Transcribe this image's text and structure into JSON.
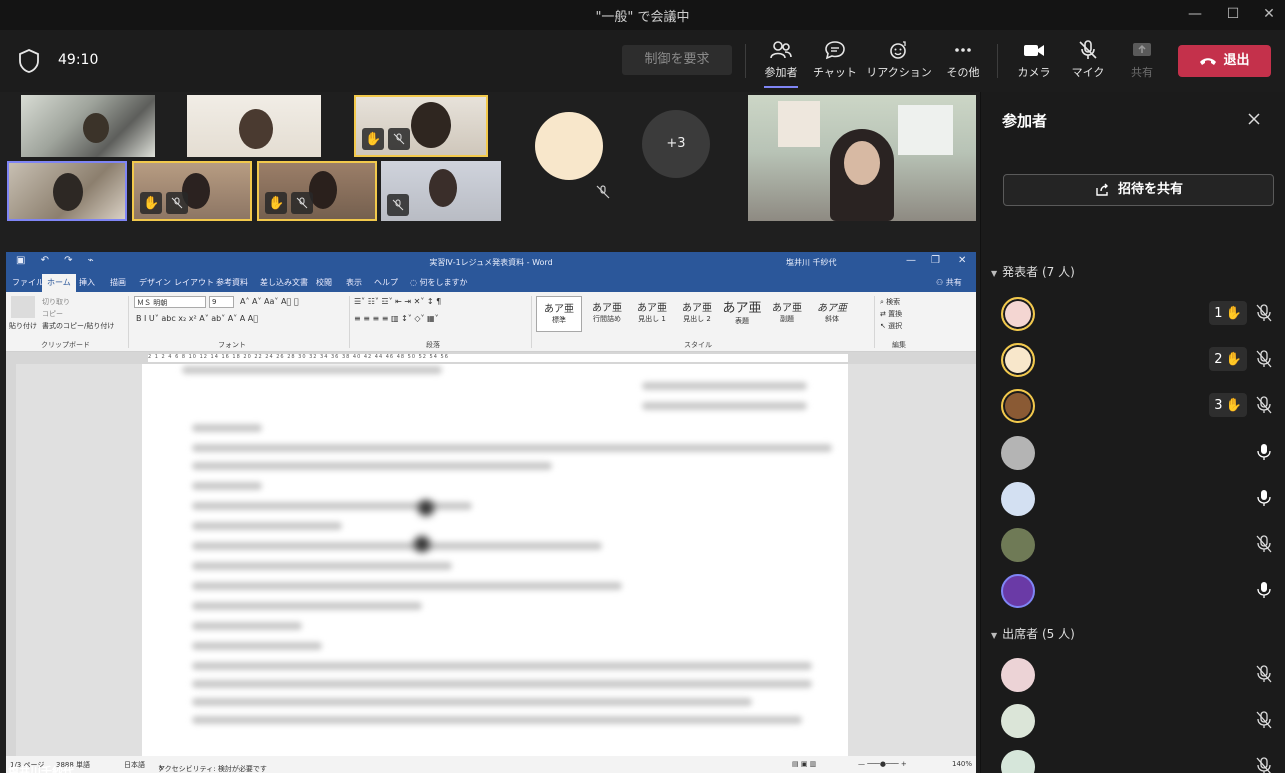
{
  "window": {
    "title": "\"一般\" で会議中",
    "minimize": "—",
    "maximize": "☐",
    "close": "✕"
  },
  "toolbar": {
    "timer": "49:10",
    "request_control": "制御を要求",
    "participants": "参加者",
    "chat": "チャット",
    "reactions": "リアクション",
    "more": "その他",
    "camera": "カメラ",
    "mic": "マイク",
    "share": "共有",
    "leave": "退出"
  },
  "video_strip": {
    "overflow_count": "+3"
  },
  "word": {
    "doc_title": "実習Ⅳ-1レジュメ発表資料 - Word",
    "user": "塩井川 千紗代",
    "tabs": [
      "ファイル",
      "ホーム",
      "挿入",
      "描画",
      "デザイン",
      "レイアウト",
      "参考資料",
      "差し込み文書",
      "校閲",
      "表示",
      "ヘルプ",
      "何をしますか"
    ],
    "share_label": "共有",
    "clipboard": {
      "paste": "貼り付け",
      "cut": "切り取り",
      "copy": "コピー",
      "format_painter": "書式のコピー/貼り付け",
      "group": "クリップボード"
    },
    "font": {
      "name": "ＭＳ 明朝",
      "size": "9",
      "group": "フォント"
    },
    "paragraph_group": "段落",
    "styles": [
      {
        "sample": "あア亜",
        "name": "標準"
      },
      {
        "sample": "あア亜",
        "name": "行間詰め"
      },
      {
        "sample": "あア亜",
        "name": "見出し 1"
      },
      {
        "sample": "あア亜",
        "name": "見出し 2"
      },
      {
        "sample": "あア亜",
        "name": "表題"
      },
      {
        "sample": "あア亜",
        "name": "副題"
      },
      {
        "sample": "あア亜",
        "name": "斜体"
      }
    ],
    "styles_group": "スタイル",
    "editing": {
      "find": "検索",
      "replace": "置換",
      "select": "選択",
      "group": "編集"
    },
    "ruler": "2 1 2 4 6 8 10 12 14 16 18 20 22 24 26 28 30 32 34 36 38 40 42 44 46 48 50 52 54 56",
    "status": {
      "page": "1/3 ページ",
      "words": "3888 単語",
      "language": "日本語",
      "accessibility": "アクセシビリティ: 検討が必要です",
      "zoom": "140%"
    }
  },
  "shared_by": "塩井川千紗代",
  "panel": {
    "title": "参加者",
    "invite": "招待を共有",
    "presenters_header": "発表者 (7 人)",
    "attendees_header": "出席者 (5 人)",
    "presenters": [
      {
        "avatar_color": "#f4d6d2",
        "hand_order": "1",
        "muted": true,
        "ring": "hand"
      },
      {
        "avatar_color": "#f8e7cb",
        "hand_order": "2",
        "muted": true,
        "ring": "hand"
      },
      {
        "avatar_color": "#8a5a34",
        "hand_order": "3",
        "muted": true,
        "ring": "hand"
      },
      {
        "avatar_color": "#b4b4b4",
        "muted": false
      },
      {
        "avatar_color": "#d3e0f2",
        "muted": false
      },
      {
        "avatar_color": "#6f7a56",
        "muted": true
      },
      {
        "avatar_color": "#6a3aa6",
        "muted": false,
        "ring": "speaking"
      }
    ],
    "attendees": [
      {
        "avatar_color": "#ecd3d6",
        "muted": true
      },
      {
        "avatar_color": "#dbe5d8",
        "muted": true
      },
      {
        "avatar_color": "#d6e6da",
        "muted": true
      }
    ]
  },
  "colors": {
    "accent": "#7f85f5",
    "leave": "#c4314b",
    "hand_highlight": "#f2c94c",
    "word_blue": "#2b579a"
  }
}
